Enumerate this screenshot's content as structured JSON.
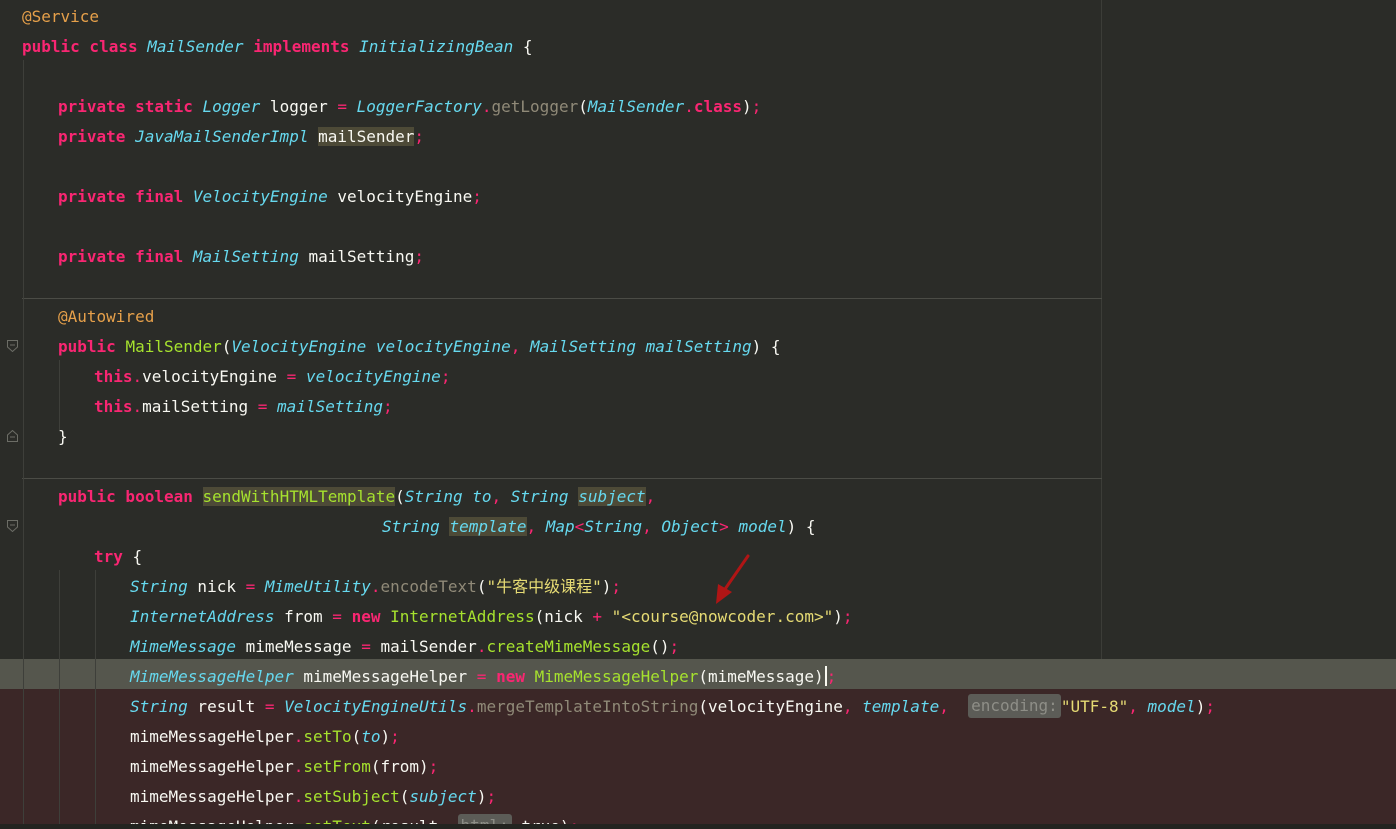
{
  "editor": {
    "lines": [
      [
        {
          "t": "@Service",
          "c": "an"
        }
      ],
      [
        {
          "t": "public class ",
          "c": "kw"
        },
        {
          "t": "MailSender",
          "c": "ty"
        },
        {
          "t": " implements ",
          "c": "kw"
        },
        {
          "t": "InitializingBean",
          "c": "ty"
        },
        {
          "t": " {",
          "c": "pl"
        }
      ],
      [],
      [
        {
          "t": "private static ",
          "c": "kw"
        },
        {
          "t": "Logger",
          "c": "ty"
        },
        {
          "t": " logger ",
          "c": "pl"
        },
        {
          "t": "=",
          "c": "pu"
        },
        {
          "t": " ",
          "c": "pl"
        },
        {
          "t": "LoggerFactory",
          "c": "ty"
        },
        {
          "t": ".",
          "c": "pu"
        },
        {
          "t": "getLogger",
          "c": "sm"
        },
        {
          "t": "(",
          "c": "pl"
        },
        {
          "t": "MailSender",
          "c": "ty"
        },
        {
          "t": ".",
          "c": "pu"
        },
        {
          "t": "class",
          "c": "kw"
        },
        {
          "t": ")",
          "c": "pl"
        },
        {
          "t": ";",
          "c": "pu"
        }
      ],
      [
        {
          "t": "private ",
          "c": "kw"
        },
        {
          "t": "JavaMailSenderImpl",
          "c": "ty"
        },
        {
          "t": " ",
          "c": "pl"
        },
        {
          "t": "mailSender",
          "c": "pl",
          "h": true
        },
        {
          "t": ";",
          "c": "pu"
        }
      ],
      [],
      [
        {
          "t": "private final ",
          "c": "kw"
        },
        {
          "t": "VelocityEngine",
          "c": "ty"
        },
        {
          "t": " velocityEngine",
          "c": "pl"
        },
        {
          "t": ";",
          "c": "pu"
        }
      ],
      [],
      [
        {
          "t": "private final ",
          "c": "kw"
        },
        {
          "t": "MailSetting",
          "c": "ty"
        },
        {
          "t": " mailSetting",
          "c": "pl"
        },
        {
          "t": ";",
          "c": "pu"
        }
      ],
      [],
      [
        {
          "t": "@Autowired",
          "c": "an"
        }
      ],
      [
        {
          "t": "public ",
          "c": "kw"
        },
        {
          "t": "MailSender",
          "c": "fn"
        },
        {
          "t": "(",
          "c": "pl"
        },
        {
          "t": "VelocityEngine velocityEngine",
          "c": "par"
        },
        {
          "t": ", ",
          "c": "pu"
        },
        {
          "t": "MailSetting mailSetting",
          "c": "par"
        },
        {
          "t": ") {",
          "c": "pl"
        }
      ],
      [
        {
          "t": "this",
          "c": "kw"
        },
        {
          "t": ".",
          "c": "pu"
        },
        {
          "t": "velocityEngine ",
          "c": "pl"
        },
        {
          "t": "=",
          "c": "pu"
        },
        {
          "t": " ",
          "c": "pl"
        },
        {
          "t": "velocityEngine",
          "c": "par"
        },
        {
          "t": ";",
          "c": "pu"
        }
      ],
      [
        {
          "t": "this",
          "c": "kw"
        },
        {
          "t": ".",
          "c": "pu"
        },
        {
          "t": "mailSetting ",
          "c": "pl"
        },
        {
          "t": "=",
          "c": "pu"
        },
        {
          "t": " ",
          "c": "pl"
        },
        {
          "t": "mailSetting",
          "c": "par"
        },
        {
          "t": ";",
          "c": "pu"
        }
      ],
      [
        {
          "t": "}",
          "c": "pl"
        }
      ],
      [],
      [
        {
          "t": "public boolean ",
          "c": "kw"
        },
        {
          "t": "sendWithHTMLTemplate",
          "c": "fn",
          "h": true
        },
        {
          "t": "(",
          "c": "pl"
        },
        {
          "t": "String to",
          "c": "par"
        },
        {
          "t": ", ",
          "c": "pu"
        },
        {
          "t": "String ",
          "c": "par"
        },
        {
          "t": "subject",
          "c": "par",
          "h": true
        },
        {
          "t": ",",
          "c": "pu"
        }
      ],
      [
        {
          "t": "String ",
          "c": "par"
        },
        {
          "t": "template",
          "c": "par",
          "h": true
        },
        {
          "t": ", ",
          "c": "pu"
        },
        {
          "t": "Map",
          "c": "par"
        },
        {
          "t": "<",
          "c": "pu"
        },
        {
          "t": "String",
          "c": "par"
        },
        {
          "t": ", ",
          "c": "pu"
        },
        {
          "t": "Object",
          "c": "par"
        },
        {
          "t": "> ",
          "c": "pu"
        },
        {
          "t": "model",
          "c": "par"
        },
        {
          "t": ") {",
          "c": "pl"
        }
      ],
      [
        {
          "t": "try",
          "c": "kw"
        },
        {
          "t": " {",
          "c": "pl"
        }
      ],
      [
        {
          "t": "String",
          "c": "ty"
        },
        {
          "t": " nick ",
          "c": "pl"
        },
        {
          "t": "=",
          "c": "pu"
        },
        {
          "t": " ",
          "c": "pl"
        },
        {
          "t": "MimeUtility",
          "c": "ty"
        },
        {
          "t": ".",
          "c": "pu"
        },
        {
          "t": "encodeText",
          "c": "sm"
        },
        {
          "t": "(",
          "c": "pl"
        },
        {
          "t": "\"牛客中级课程\"",
          "c": "str"
        },
        {
          "t": ")",
          "c": "pl"
        },
        {
          "t": ";",
          "c": "pu"
        }
      ],
      [
        {
          "t": "InternetAddress",
          "c": "ty"
        },
        {
          "t": " from ",
          "c": "pl"
        },
        {
          "t": "=",
          "c": "pu"
        },
        {
          "t": " ",
          "c": "pl"
        },
        {
          "t": "new ",
          "c": "kw"
        },
        {
          "t": "InternetAddress",
          "c": "fn"
        },
        {
          "t": "(nick ",
          "c": "pl"
        },
        {
          "t": "+",
          "c": "pu"
        },
        {
          "t": " \"<course@nowcoder.com>\"",
          "c": "str"
        },
        {
          "t": ")",
          "c": "pl"
        },
        {
          "t": ";",
          "c": "pu"
        }
      ],
      [
        {
          "t": "MimeMessage",
          "c": "ty"
        },
        {
          "t": " mimeMessage ",
          "c": "pl"
        },
        {
          "t": "=",
          "c": "pu"
        },
        {
          "t": " mailSender",
          "c": "pl"
        },
        {
          "t": ".",
          "c": "pu"
        },
        {
          "t": "createMimeMessage",
          "c": "mc"
        },
        {
          "t": "()",
          "c": "pl"
        },
        {
          "t": ";",
          "c": "pu"
        }
      ],
      [
        {
          "t": "MimeMessageHelper",
          "c": "ty"
        },
        {
          "t": " mimeMessageHelper ",
          "c": "pl"
        },
        {
          "t": "=",
          "c": "pu"
        },
        {
          "t": " ",
          "c": "pl"
        },
        {
          "t": "new ",
          "c": "kw"
        },
        {
          "t": "MimeMessageHelper",
          "c": "fn"
        },
        {
          "t": "(mimeMessage)",
          "c": "pl"
        },
        {
          "caret": true
        },
        {
          "t": ";",
          "c": "pu"
        }
      ],
      [
        {
          "t": "String",
          "c": "ty"
        },
        {
          "t": " result ",
          "c": "pl"
        },
        {
          "t": "=",
          "c": "pu"
        },
        {
          "t": " ",
          "c": "pl"
        },
        {
          "t": "VelocityEngineUtils",
          "c": "ty"
        },
        {
          "t": ".",
          "c": "pu"
        },
        {
          "t": "mergeTemplateIntoString",
          "c": "sm"
        },
        {
          "t": "(velocityEngine",
          "c": "pl"
        },
        {
          "t": ", ",
          "c": "pu"
        },
        {
          "t": "template",
          "c": "par"
        },
        {
          "t": ", ",
          "c": "pu"
        },
        {
          "t": " ",
          "c": "pl"
        },
        {
          "t": "encoding:",
          "c": "hint"
        },
        {
          "t": "\"UTF-8\"",
          "c": "str"
        },
        {
          "t": ", ",
          "c": "pu"
        },
        {
          "t": "model",
          "c": "par"
        },
        {
          "t": ")",
          "c": "pl"
        },
        {
          "t": ";",
          "c": "pu"
        }
      ],
      [
        {
          "t": "mimeMessageHelper",
          "c": "pl"
        },
        {
          "t": ".",
          "c": "pu"
        },
        {
          "t": "setTo",
          "c": "mc"
        },
        {
          "t": "(",
          "c": "pl"
        },
        {
          "t": "to",
          "c": "par"
        },
        {
          "t": ")",
          "c": "pl"
        },
        {
          "t": ";",
          "c": "pu"
        }
      ],
      [
        {
          "t": "mimeMessageHelper",
          "c": "pl"
        },
        {
          "t": ".",
          "c": "pu"
        },
        {
          "t": "setFrom",
          "c": "mc"
        },
        {
          "t": "(from)",
          "c": "pl"
        },
        {
          "t": ";",
          "c": "pu"
        }
      ],
      [
        {
          "t": "mimeMessageHelper",
          "c": "pl"
        },
        {
          "t": ".",
          "c": "pu"
        },
        {
          "t": "setSubject",
          "c": "mc"
        },
        {
          "t": "(",
          "c": "pl"
        },
        {
          "t": "subject",
          "c": "par"
        },
        {
          "t": ")",
          "c": "pl"
        },
        {
          "t": ";",
          "c": "pu"
        }
      ],
      [
        {
          "t": "mimeMessageHelper",
          "c": "pl"
        },
        {
          "t": ".",
          "c": "pu"
        },
        {
          "t": "setText",
          "c": "mc"
        },
        {
          "t": "(result, ",
          "c": "pl"
        },
        {
          "t": "html:",
          "c": "hint"
        },
        {
          "t": " true)",
          "c": "pl"
        },
        {
          "t": ";",
          "c": "pu"
        }
      ]
    ]
  }
}
